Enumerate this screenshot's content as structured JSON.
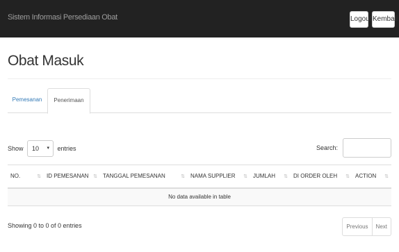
{
  "navbar": {
    "brand": "Sistem Informasi Persediaan Obat",
    "logout_label": "Logout",
    "kembali_label": "Kembali"
  },
  "page": {
    "title": "Obat Masuk"
  },
  "tabs": [
    {
      "label": "Pemesanan"
    },
    {
      "label": "Penerimaan"
    }
  ],
  "table_controls": {
    "show_label": "Show",
    "length_value": "10",
    "entries_label": "entries",
    "search_label": "Search:",
    "search_value": ""
  },
  "table": {
    "columns": [
      {
        "label": "NO."
      },
      {
        "label": "ID PEMESANAN"
      },
      {
        "label": "TANGGAL PEMESANAN"
      },
      {
        "label": "NAMA SUPPLIER"
      },
      {
        "label": "JUMLAH"
      },
      {
        "label": "DI ORDER OLEH"
      },
      {
        "label": "ACTION"
      }
    ],
    "empty_message": "No data available in table"
  },
  "footer": {
    "info": "Showing 0 to 0 of 0 entries",
    "previous_label": "Previous",
    "next_label": "Next"
  }
}
